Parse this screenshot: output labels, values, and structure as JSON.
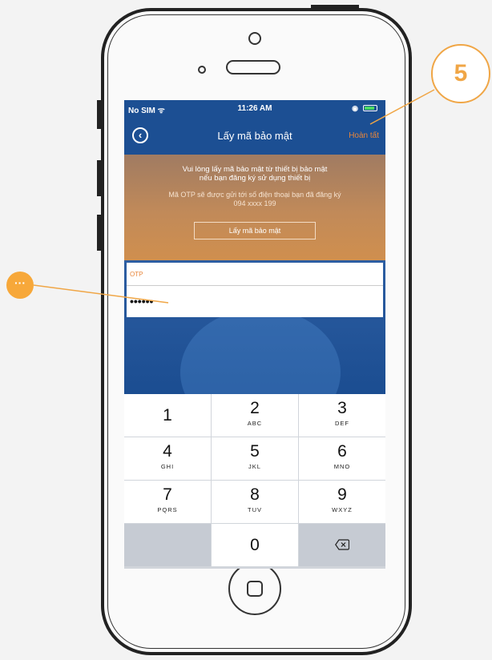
{
  "colors": {
    "accent": "#e8863a",
    "callout": "#f0a646",
    "nav_blue": "#1c4f93",
    "banner_orange": "#c18a59"
  },
  "status_bar": {
    "carrier": "No SIM ᯤ",
    "time": "11:26 AM",
    "alarm_glyph": "◉"
  },
  "nav": {
    "back_icon": "‹",
    "title": "Lấy mã bảo mật",
    "done_label": "Hoàn tất"
  },
  "banner": {
    "line1": "Vui lòng lấy mã bảo mật từ thiết bị bảo mật",
    "line2": "nếu bạn đăng ký sử dụng thiết bị",
    "line3": "Mã OTP sẽ được gửi tới số điện thoại bạn đã đăng ký",
    "line4": "094 xxxx 199",
    "button_label": "Lấy mã bảo mật"
  },
  "otp_field": {
    "label": "OTP",
    "value": "••••••"
  },
  "keypad": {
    "keys": [
      {
        "digit": "1",
        "letters": ""
      },
      {
        "digit": "2",
        "letters": "ABC"
      },
      {
        "digit": "3",
        "letters": "DEF"
      },
      {
        "digit": "4",
        "letters": "GHI"
      },
      {
        "digit": "5",
        "letters": "JKL"
      },
      {
        "digit": "6",
        "letters": "MNO"
      },
      {
        "digit": "7",
        "letters": "PQRS"
      },
      {
        "digit": "8",
        "letters": "TUV"
      },
      {
        "digit": "9",
        "letters": "WXYZ"
      },
      {
        "digit": "0",
        "letters": ""
      }
    ],
    "delete_icon": "backspace-icon"
  },
  "callouts": {
    "step_number": "5",
    "more_label": "···"
  }
}
